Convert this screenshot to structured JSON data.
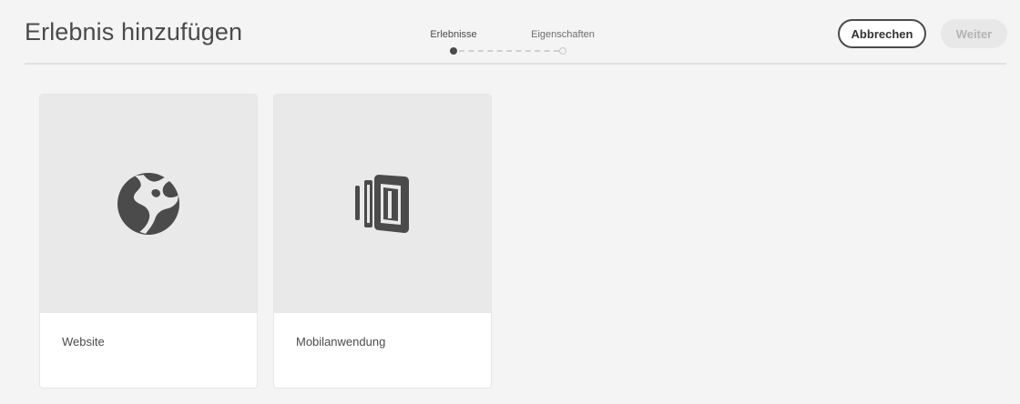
{
  "header": {
    "title": "Erlebnis hinzufügen"
  },
  "wizard": {
    "steps": [
      {
        "label": "Erlebnisse",
        "state": "current"
      },
      {
        "label": "Eigenschaften",
        "state": "pending"
      }
    ]
  },
  "actions": {
    "cancel_label": "Abbrechen",
    "next_label": "Weiter",
    "next_enabled": false
  },
  "cards": [
    {
      "label": "Website",
      "icon": "globe-icon"
    },
    {
      "label": "Mobilanwendung",
      "icon": "mobile-devices-icon"
    }
  ],
  "colors": {
    "background": "#f4f4f4",
    "card_preview": "#e9e9e9",
    "icon": "#4b4b4b",
    "disabled_button": "#e8e8e8"
  }
}
